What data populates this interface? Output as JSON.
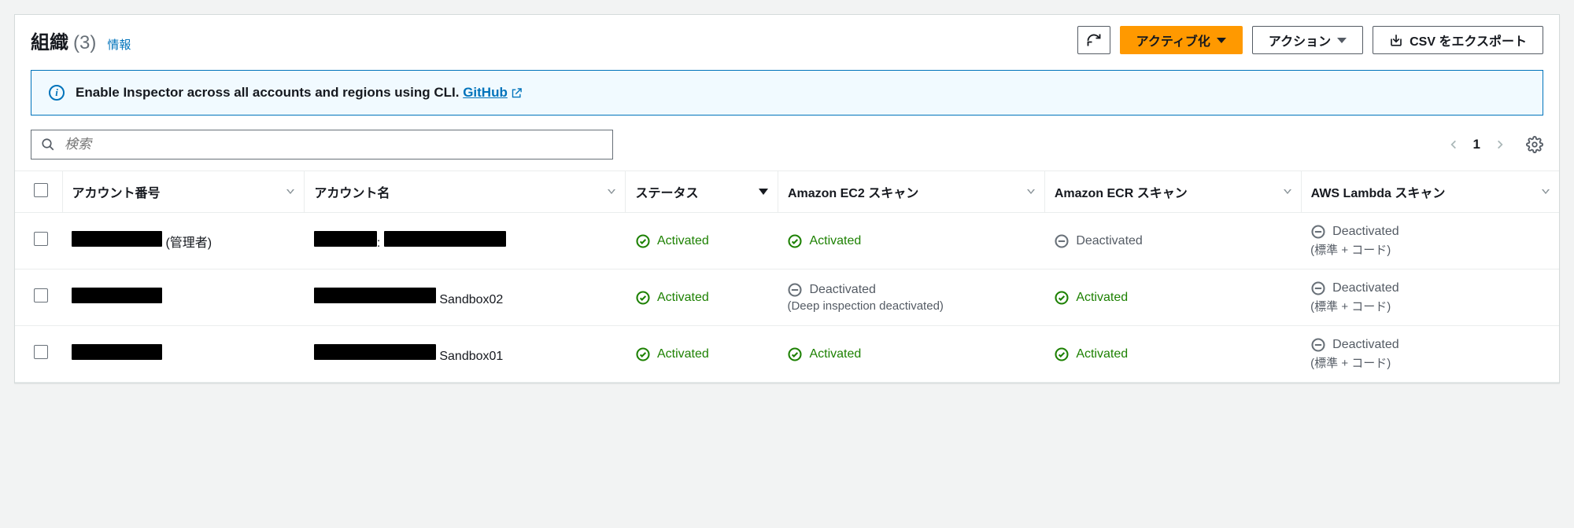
{
  "header": {
    "title": "組織",
    "count": "(3)",
    "info_link": "情報"
  },
  "buttons": {
    "activate": "アクティブ化",
    "actions": "アクション",
    "export_csv": "CSV をエクスポート"
  },
  "banner": {
    "text": "Enable Inspector across all accounts and regions using CLI.",
    "link_label": "GitHub"
  },
  "search": {
    "placeholder": "検索"
  },
  "pagination": {
    "page": "1"
  },
  "columns": {
    "account_no": "アカウント番号",
    "account_name": "アカウント名",
    "status": "ステータス",
    "ec2": "Amazon EC2 スキャン",
    "ecr": "Amazon ECR スキャン",
    "lambda": "AWS Lambda スキャン"
  },
  "status_labels": {
    "activated": "Activated",
    "deactivated": "Deactivated",
    "deep_deactivated": "(Deep inspection deactivated)",
    "std_code": "(標準 + コード)"
  },
  "rows": [
    {
      "account_no_suffix": "(管理者)",
      "account_name_suffix": "",
      "status": "activated",
      "ec2": {
        "state": "activated"
      },
      "ecr": {
        "state": "deactivated"
      },
      "lambda": {
        "state": "deactivated",
        "sub": "std_code"
      }
    },
    {
      "account_no_suffix": "",
      "account_name_suffix": "Sandbox02",
      "status": "activated",
      "ec2": {
        "state": "deactivated",
        "sub": "deep_deactivated"
      },
      "ecr": {
        "state": "activated"
      },
      "lambda": {
        "state": "deactivated",
        "sub": "std_code"
      }
    },
    {
      "account_no_suffix": "",
      "account_name_suffix": "Sandbox01",
      "status": "activated",
      "ec2": {
        "state": "activated"
      },
      "ecr": {
        "state": "activated"
      },
      "lambda": {
        "state": "deactivated",
        "sub": "std_code"
      }
    }
  ]
}
